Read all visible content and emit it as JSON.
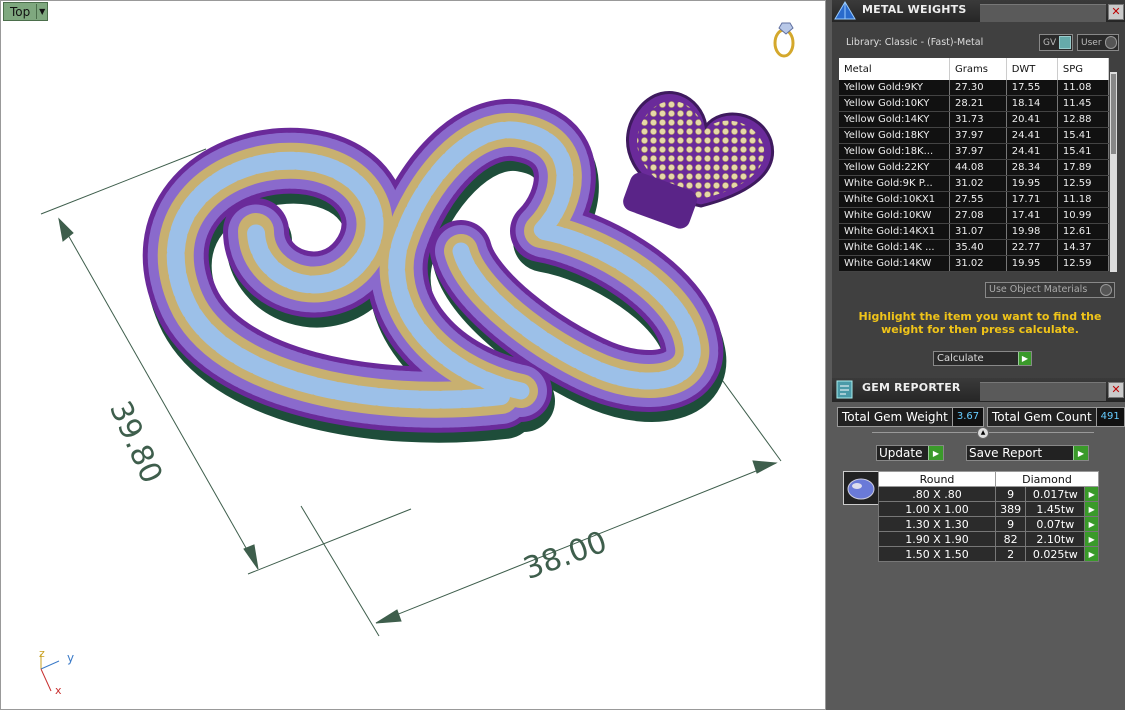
{
  "viewport": {
    "view_name": "Top",
    "dimension_vertical": "39.80",
    "dimension_horizontal": "38.00",
    "axis_labels": {
      "z": "z",
      "y": "y",
      "x": "x"
    }
  },
  "metal_weights": {
    "title": "METAL WEIGHTS",
    "library": "Library: Classic - (Fast)-Metal",
    "toggle_gv": "GV",
    "toggle_user": "User",
    "columns": [
      "Metal",
      "Grams",
      "DWT",
      "SPG"
    ],
    "rows": [
      [
        "Yellow Gold:9KY",
        "27.30",
        "17.55",
        "11.08"
      ],
      [
        "Yellow Gold:10KY",
        "28.21",
        "18.14",
        "11.45"
      ],
      [
        "Yellow Gold:14KY",
        "31.73",
        "20.41",
        "12.88"
      ],
      [
        "Yellow Gold:18KY",
        "37.97",
        "24.41",
        "15.41"
      ],
      [
        "Yellow Gold:18K...",
        "37.97",
        "24.41",
        "15.41"
      ],
      [
        "Yellow Gold:22KY",
        "44.08",
        "28.34",
        "17.89"
      ],
      [
        "White Gold:9K P...",
        "31.02",
        "19.95",
        "12.59"
      ],
      [
        "White Gold:10KX1",
        "27.55",
        "17.71",
        "11.18"
      ],
      [
        "White Gold:10KW",
        "27.08",
        "17.41",
        "10.99"
      ],
      [
        "White Gold:14KX1",
        "31.07",
        "19.98",
        "12.61"
      ],
      [
        "White Gold:14K ...",
        "35.40",
        "22.77",
        "14.37"
      ],
      [
        "White Gold:14KW",
        "31.02",
        "19.95",
        "12.59"
      ]
    ],
    "use_object_materials": "Use Object Materials",
    "hint": "Highlight the item you want to find the weight for then press calculate.",
    "calculate": "Calculate"
  },
  "gem_reporter": {
    "title": "GEM REPORTER",
    "total_weight_label": "Total Gem Weight",
    "total_weight_value": "3.67",
    "total_count_label": "Total Gem Count",
    "total_count_value": "491",
    "update_label": "Update",
    "save_label": "Save Report",
    "columns": [
      "Round",
      "Diamond"
    ],
    "rows": [
      [
        ".80 X .80",
        "9",
        "0.017tw"
      ],
      [
        "1.00 X 1.00",
        "389",
        "1.45tw"
      ],
      [
        "1.30 X 1.30",
        "9",
        "0.07tw"
      ],
      [
        "1.90 X 1.90",
        "82",
        "2.10tw"
      ],
      [
        "1.50 X 1.50",
        "2",
        "0.025tw"
      ]
    ]
  }
}
